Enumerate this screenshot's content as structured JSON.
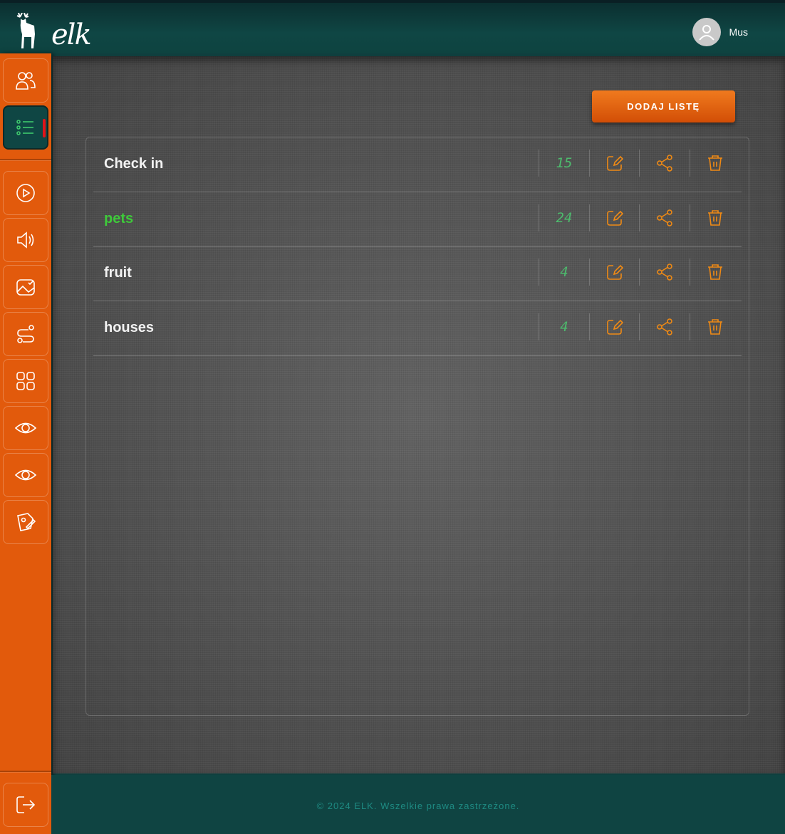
{
  "app": {
    "logo_text": "elk"
  },
  "user": {
    "name": "Mus"
  },
  "toolbar": {
    "add_list_label": "DODAJ LISTĘ"
  },
  "lists": [
    {
      "name": "Check in",
      "count": "15",
      "highlighted": false
    },
    {
      "name": "pets",
      "count": "24",
      "highlighted": true
    },
    {
      "name": "fruit",
      "count": "4",
      "highlighted": false
    },
    {
      "name": "houses",
      "count": "4",
      "highlighted": false
    }
  ],
  "sidebar": {
    "items": [
      {
        "icon": "users-icon"
      },
      {
        "icon": "list-icon",
        "active": true
      },
      {
        "icon": "play-icon"
      },
      {
        "icon": "speaker-icon"
      },
      {
        "icon": "image-check-icon"
      },
      {
        "icon": "route-icon"
      },
      {
        "icon": "grid-icon"
      },
      {
        "icon": "eye-icon"
      },
      {
        "icon": "eye-icon"
      },
      {
        "icon": "pen-icon"
      }
    ],
    "logout_icon": "logout-icon"
  },
  "footer": {
    "copyright": "© 2024 ELK. Wszelkie prawa zastrzeżone."
  },
  "colors": {
    "accent": "#e25a0c",
    "header": "#0f4644",
    "count": "#4dbb6d",
    "highlight": "#3ec93a",
    "action_icon": "#f08a14"
  }
}
